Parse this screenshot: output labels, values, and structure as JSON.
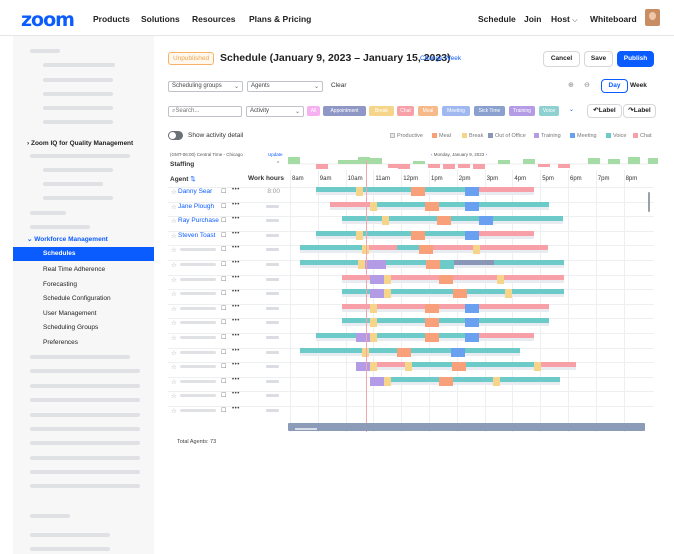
{
  "topnav": {
    "logo": "zoom",
    "items": [
      "Products",
      "Solutions",
      "Resources",
      "Plans & Pricing"
    ],
    "right": [
      "Schedule",
      "Join",
      "Host",
      "Whiteboard"
    ]
  },
  "sidebar": {
    "iq": "Zoom IQ for Quality Management",
    "wfm": "Workforce Management",
    "items": [
      "Schedules",
      "Real Time Adherence",
      "Forecasting",
      "Schedule Configuration",
      "User Management",
      "Scheduling Groups",
      "Preferences"
    ],
    "active_index": 0
  },
  "header": {
    "badge": "Unpublished",
    "title": "Schedule (January 9, 2023 – January 15, 2023)",
    "change_week": "Change Week",
    "cancel": "Cancel",
    "save": "Save",
    "publish": "Publish"
  },
  "filters": {
    "groups": "Scheduling groups",
    "agents": "Agents",
    "clear": "Clear",
    "view_day": "Day",
    "view_week": "Week",
    "search_placeholder": "Search...",
    "activity": "Activity",
    "label_undo": "Label",
    "label_redo": "Label"
  },
  "chips": [
    {
      "label": "All",
      "color": "#f7b0f0"
    },
    {
      "label": "Appointment",
      "color": "#8e97c6"
    },
    {
      "label": "Break",
      "color": "#f6d58a"
    },
    {
      "label": "Chat",
      "color": "#f7a0a8"
    },
    {
      "label": "Meal",
      "color": "#f7b98a"
    },
    {
      "label": "Meeting",
      "color": "#9fb9f0"
    },
    {
      "label": "Sick Time",
      "color": "#8aa0cf"
    },
    {
      "label": "Training",
      "color": "#b49be6"
    },
    {
      "label": "Voice",
      "color": "#8fd1d0"
    }
  ],
  "activity_toggle": "Show activity detail",
  "legend": [
    {
      "label": "Productive",
      "color": "#e6e8ec"
    },
    {
      "label": "Meal",
      "color": "#f7a07a"
    },
    {
      "label": "Break",
      "color": "#f6d58a"
    },
    {
      "label": "Out of Office",
      "color": "#8a96b8"
    },
    {
      "label": "Training",
      "color": "#b49be6"
    },
    {
      "label": "Meeting",
      "color": "#6aa0f0"
    },
    {
      "label": "Voice",
      "color": "#6ccbc8"
    },
    {
      "label": "Chat",
      "color": "#f7a0a8"
    }
  ],
  "grid": {
    "timezone": "(GMT-06:00) Central Time - Chicago",
    "update": "Update",
    "date": "Monday, January 9, 2023",
    "staffing": "Staffing",
    "agent_col": "Agent",
    "work_hours": "Work hours",
    "hours": [
      "8am",
      "9am",
      "10am",
      "11am",
      "12pm",
      "1pm",
      "2pm",
      "3pm",
      "4pm",
      "5pm",
      "6pm",
      "7pm",
      "8pm"
    ],
    "named_agents": [
      {
        "name": "Danny Sear",
        "hours": "8:00"
      },
      {
        "name": "Jane Plough",
        "hours": ""
      },
      {
        "name": "Ray Purchase",
        "hours": ""
      },
      {
        "name": "Steven Toast",
        "hours": ""
      }
    ],
    "total": "Total Agents: 73"
  }
}
